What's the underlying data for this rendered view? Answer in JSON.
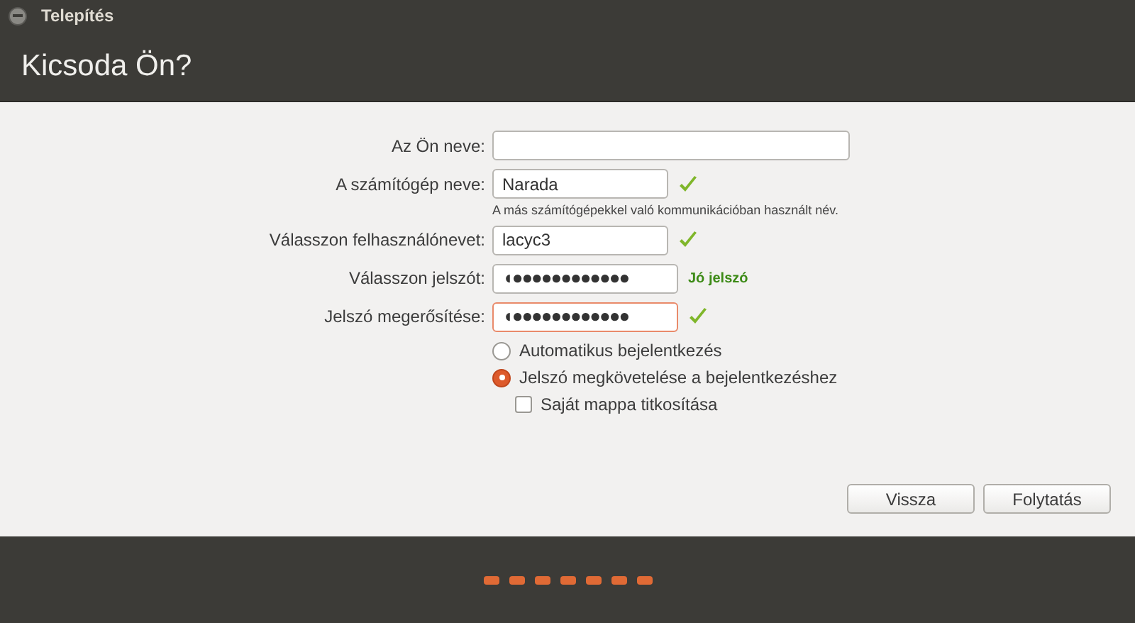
{
  "window": {
    "title": "Telepítés"
  },
  "header": {
    "title": "Kicsoda Ön?"
  },
  "fields": [
    {
      "label": "Az Ön neve:",
      "kind": "text",
      "wide": true,
      "valid": false,
      "focused": false
    },
    {
      "label": "A számítógép neve:",
      "kind": "text",
      "value": "Narada",
      "valid": true,
      "focused": false,
      "hint": "A más számítógépekkel való kommunikációban használt név."
    },
    {
      "label": "Válasszon felhasználónevet:",
      "kind": "text",
      "value": "lacyc3",
      "valid": true,
      "focused": false
    },
    {
      "label": "Válasszon jelszót:",
      "kind": "password",
      "value": "◖●●●●●●●●●●●●",
      "valid": false,
      "focused": false,
      "strength": "Jó jelszó"
    },
    {
      "label": "Jelszó megerősítése:",
      "kind": "password",
      "value": "◖●●●●●●●●●●●●",
      "valid": true,
      "focused": true
    }
  ],
  "login_options": [
    {
      "kind": "radio",
      "label": "Automatikus bejelentkezés",
      "selected": false
    },
    {
      "kind": "radio",
      "label": "Jelszó megkövetelése a bejelentkezéshez",
      "selected": true
    },
    {
      "kind": "checkbox",
      "label": "Saját mappa titkosítása",
      "checked": false
    }
  ],
  "buttons": [
    "Vissza",
    "Folytatás"
  ],
  "progress_steps": [
    {
      "kind": "dot"
    },
    {
      "kind": "dot"
    },
    {
      "kind": "dot"
    },
    {
      "kind": "dot"
    },
    {
      "kind": "dot"
    },
    {
      "kind": "dot"
    },
    {
      "kind": "dot"
    }
  ]
}
